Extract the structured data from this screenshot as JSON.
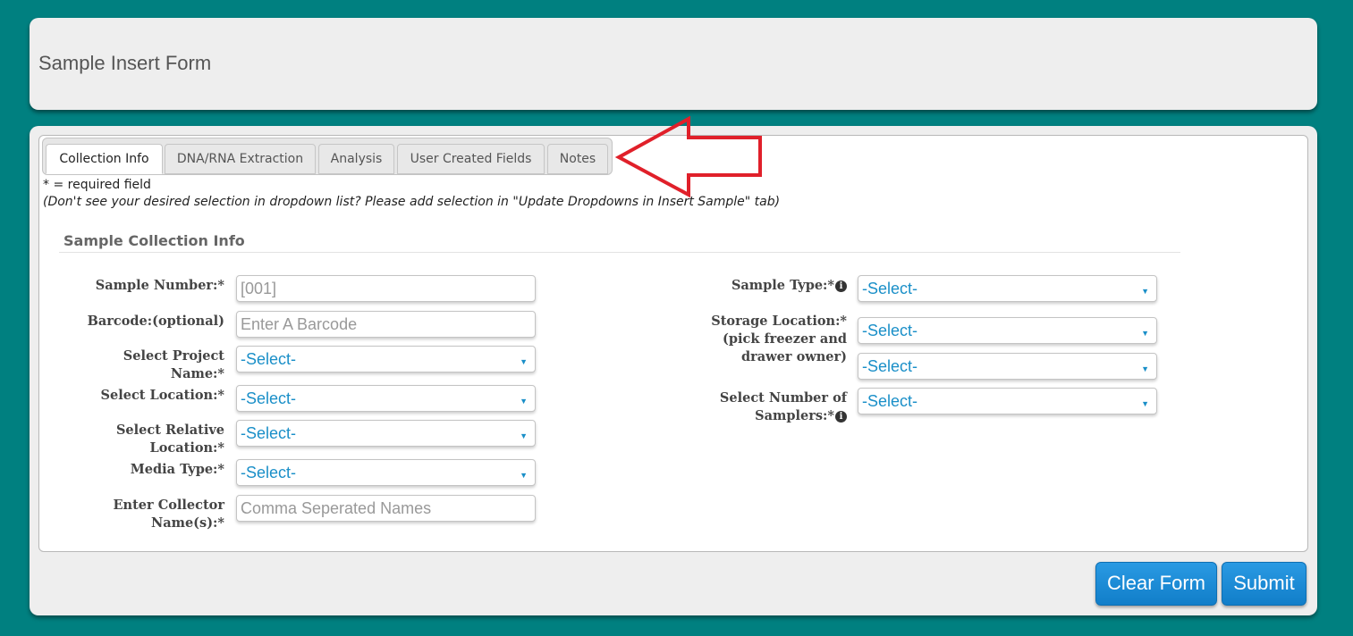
{
  "header": {
    "title": "Sample Insert Form"
  },
  "tabs": [
    {
      "label": "Collection Info",
      "active": true
    },
    {
      "label": "DNA/RNA Extraction",
      "active": false
    },
    {
      "label": "Analysis",
      "active": false
    },
    {
      "label": "User Created Fields",
      "active": false
    },
    {
      "label": "Notes",
      "active": false
    }
  ],
  "notes": {
    "required": "* = required field",
    "dropdown_hint": "(Don't see your desired selection in dropdown list? Please add selection in \"Update Dropdowns in Insert Sample\" tab)"
  },
  "section": {
    "title": "Sample Collection Info"
  },
  "left_fields": {
    "sample_number": {
      "label": "Sample Number:*",
      "placeholder": "[001]"
    },
    "barcode": {
      "label": "Barcode:(optional)",
      "placeholder": "Enter A Barcode"
    },
    "project_name": {
      "label_1": "Select Project",
      "label_2": "Name:*",
      "value": "-Select-"
    },
    "location": {
      "label": "Select Location:*",
      "value": "-Select-"
    },
    "relative_location": {
      "label_1": "Select Relative",
      "label_2": "Location:*",
      "value": "-Select-"
    },
    "media_type": {
      "label": "Media Type:*",
      "value": "-Select-"
    },
    "collector": {
      "label_1": "Enter Collector",
      "label_2": "Name(s):*",
      "placeholder": "Comma Seperated Names"
    }
  },
  "right_fields": {
    "sample_type": {
      "label": "Sample Type:*",
      "value": "-Select-"
    },
    "storage_location": {
      "label_1": "Storage Location:*",
      "label_2": "(pick freezer and",
      "label_3": "drawer owner)",
      "freezer_value": "-Select-",
      "owner_value": "-Select-"
    },
    "samplers": {
      "label_1": "Select Number of",
      "label_2": "Samplers:*",
      "value": "-Select-"
    }
  },
  "buttons": {
    "clear": "Clear Form",
    "submit": "Submit"
  },
  "icons": {
    "info": "info-icon",
    "caret": "chevron-down-icon",
    "arrow": "left-arrow-annotation"
  },
  "colors": {
    "background": "#008080",
    "button": "#1a8fd6",
    "select_text": "#1a8fc8",
    "arrow": "#e0202a"
  }
}
